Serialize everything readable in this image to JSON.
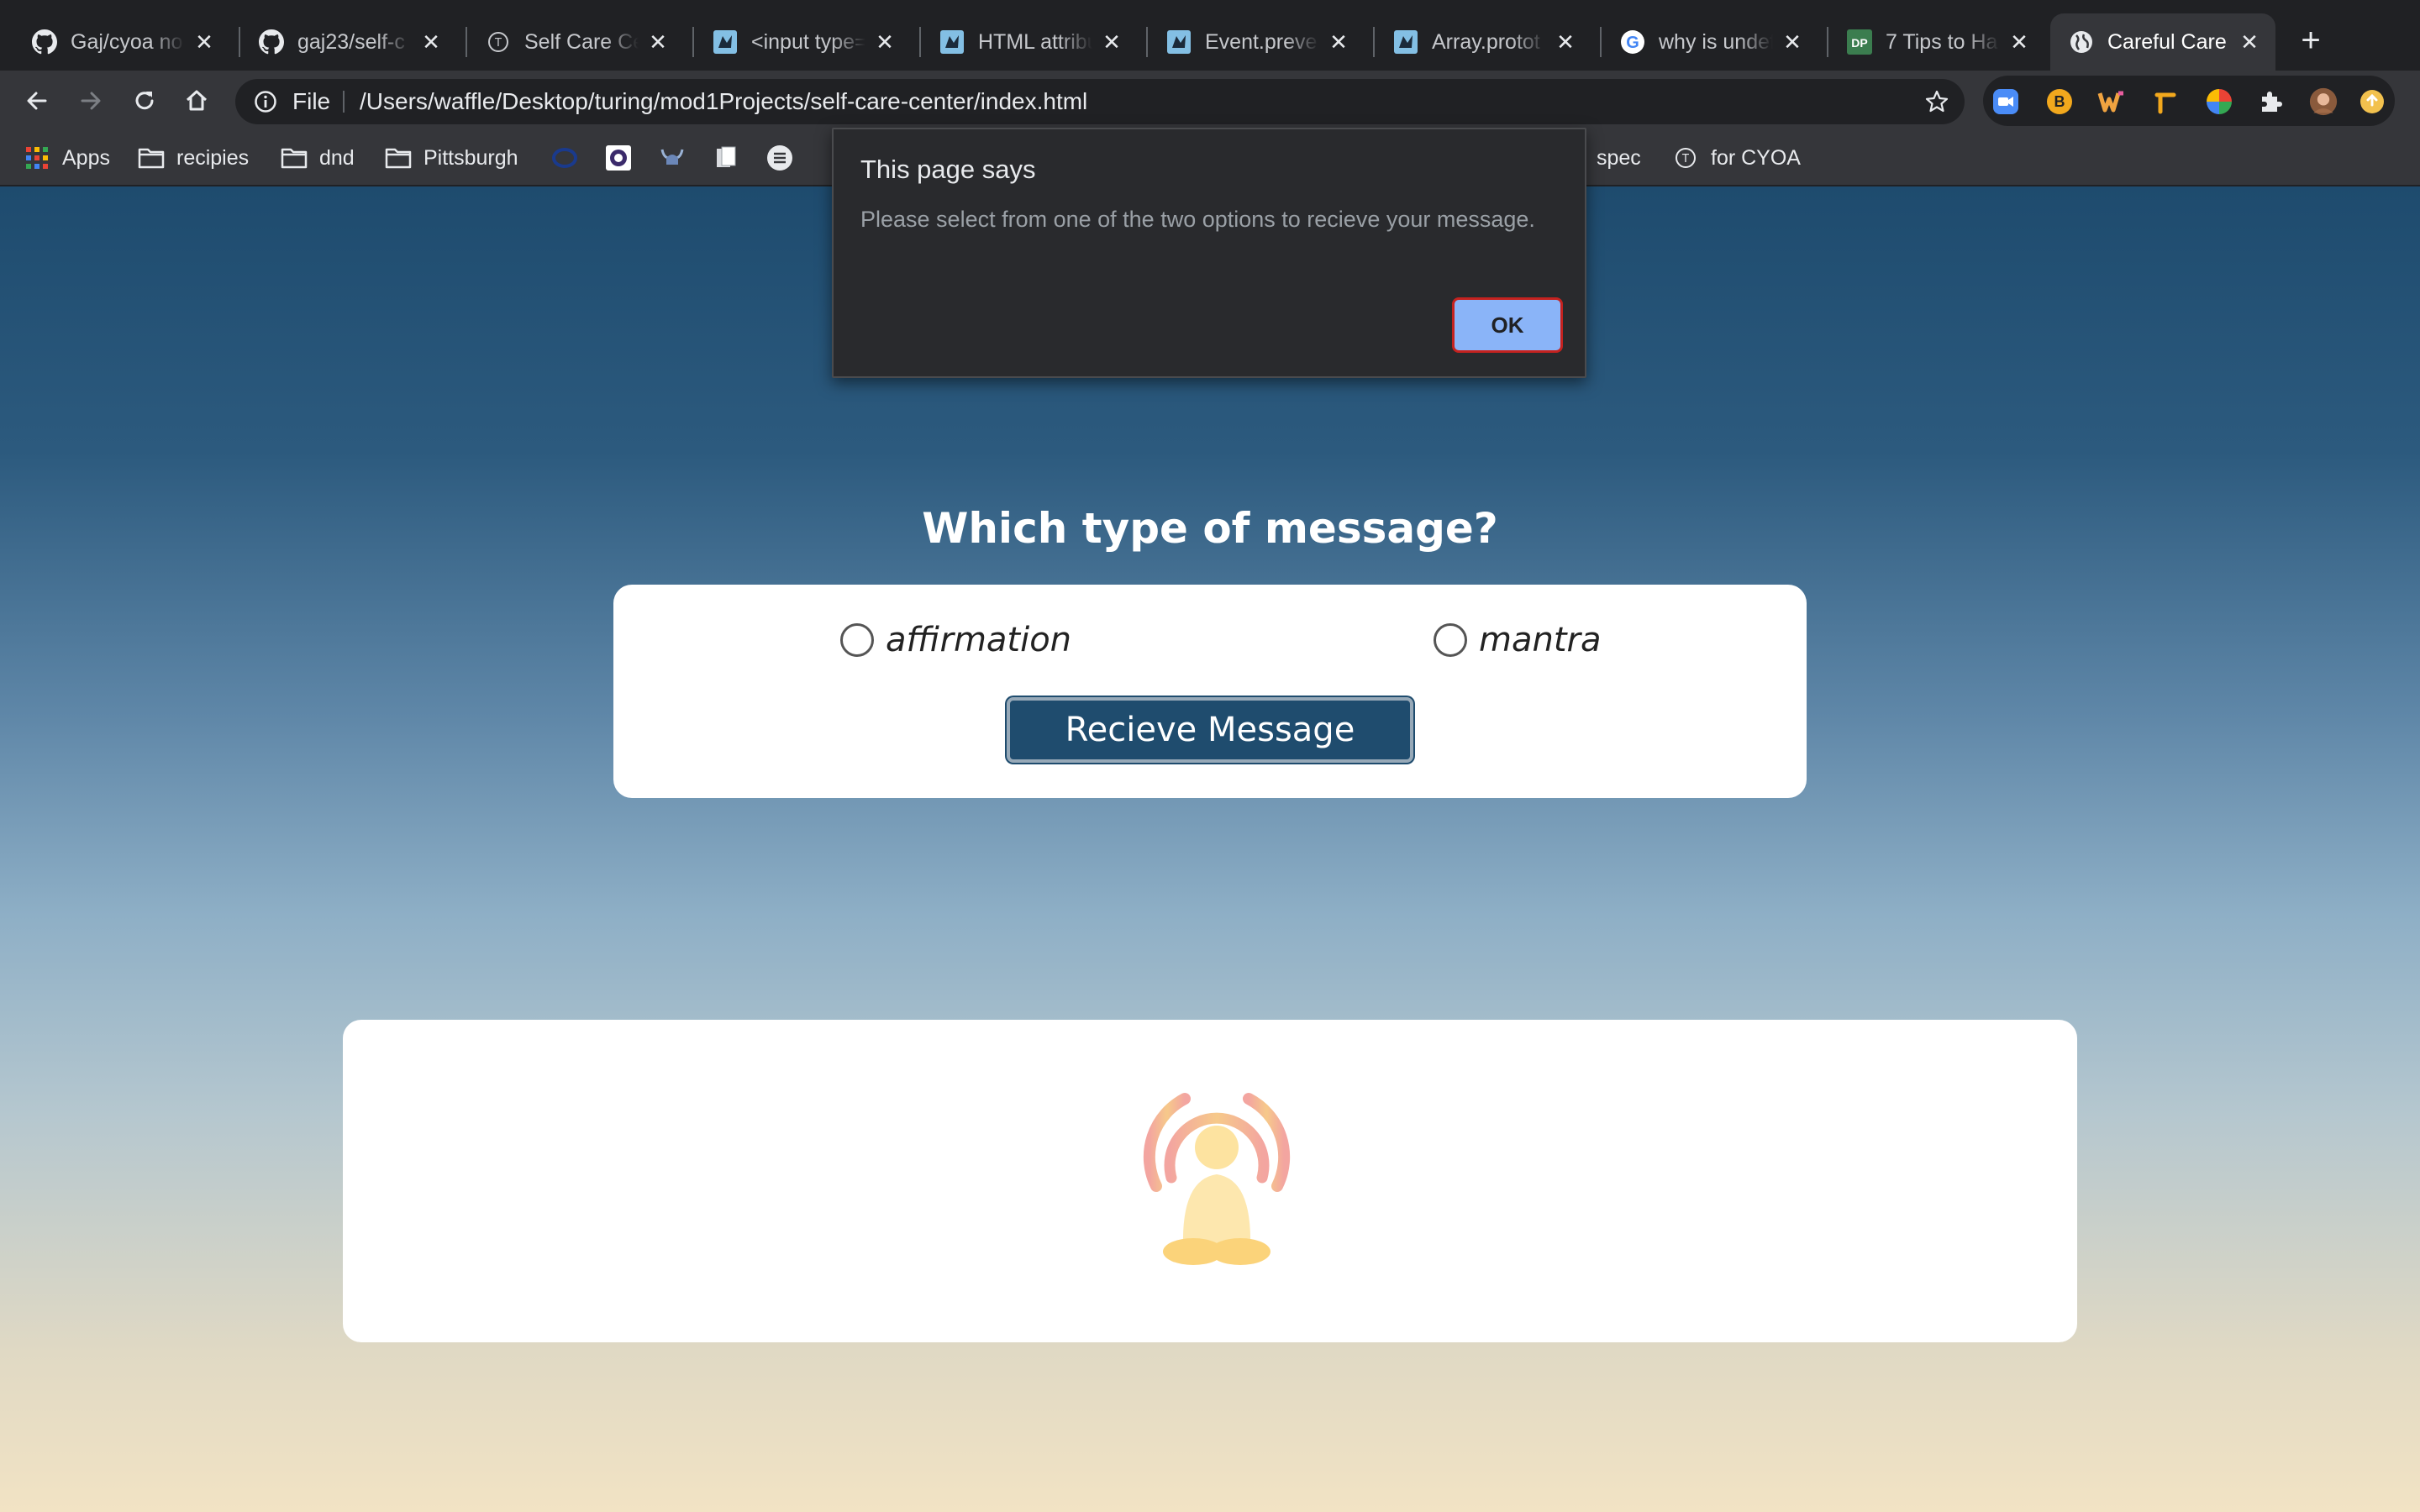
{
  "browser": {
    "tabs": [
      {
        "title": "Gaj/cyoa no",
        "icon": "github-icon"
      },
      {
        "title": "gaj23/self-c",
        "icon": "github-icon"
      },
      {
        "title": "Self Care Ce",
        "icon": "turing-icon"
      },
      {
        "title": "<input type=",
        "icon": "mdn-icon"
      },
      {
        "title": "HTML attribu",
        "icon": "mdn-icon"
      },
      {
        "title": "Event.preve",
        "icon": "mdn-icon"
      },
      {
        "title": "Array.protot",
        "icon": "mdn-icon"
      },
      {
        "title": "why is undef",
        "icon": "google-icon"
      },
      {
        "title": "7 Tips to Ha",
        "icon": "dp-icon",
        "icon_text": "DP"
      },
      {
        "title": "Careful Care",
        "icon": "globe-icon",
        "active": true
      }
    ],
    "new_tab_label": "+",
    "omnibox": {
      "scheme_label": "File",
      "url": "/Users/waffle/Desktop/turing/mod1Projects/self-care-center/index.html"
    },
    "bookmarks": [
      {
        "label": "Apps",
        "icon": "apps-grid-icon"
      },
      {
        "label": "recipies",
        "icon": "folder-icon"
      },
      {
        "label": "dnd",
        "icon": "folder-icon"
      },
      {
        "label": "Pittsburgh",
        "icon": "folder-icon"
      },
      {
        "label": "spec",
        "icon": ""
      },
      {
        "label": "for CYOA",
        "icon": "turing-icon"
      }
    ],
    "extension_badge_letter": "B"
  },
  "page": {
    "question": "Which type of message?",
    "options": [
      {
        "label": "affirmation",
        "selected": false
      },
      {
        "label": "mantra",
        "selected": false
      }
    ],
    "receive_button_label": "Recieve Message",
    "illustration": "meditation-icon"
  },
  "dialog": {
    "title": "This page says",
    "message": "Please select from one of the two options to recieve your message.",
    "ok_label": "OK"
  },
  "colors": {
    "page_gradient_top": "#1e4b6e",
    "page_gradient_bottom": "#f2e3c4",
    "button_bg": "#1f4c6e",
    "dialog_ok_bg": "#8ab4f8"
  }
}
